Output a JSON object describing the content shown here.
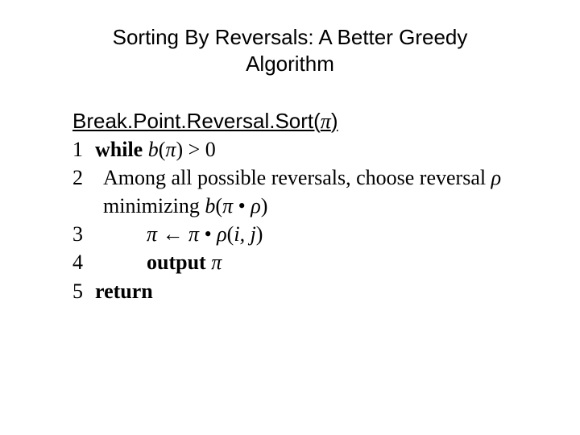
{
  "title": "Sorting By Reversals: A Better Greedy Algorithm",
  "fn": {
    "name_pre": "Break.Point.Reversal.Sort(",
    "name_arg": "π",
    "name_post": ")"
  },
  "steps": {
    "s1_num": "1",
    "s1_while": "while",
    "s1_b": "b",
    "s1_rest1": "(",
    "s1_pi": "π",
    "s1_rest2": ") > 0",
    "s2_num": "2",
    "s2_text1": "Among all possible reversals, choose reversal  ",
    "s2_rho": "ρ",
    "s2_text2": "  minimizing ",
    "s2_b": "b",
    "s2_paren": "(",
    "s2_pi": "π",
    "s2_dot": " • ",
    "s2_rho2": "ρ",
    "s2_close": ")",
    "s3_num": "3",
    "s3_pi1": "π",
    "s3_arrow": " ← ",
    "s3_pi2": "π",
    "s3_dot": " • ",
    "s3_rho": "ρ",
    "s3_paren": "(",
    "s3_i": "i",
    "s3_comma": ", ",
    "s3_j": "j",
    "s3_close": ")",
    "s4_num": "4",
    "s4_out": "output",
    "s4_pi": " π",
    "s5_num": "5",
    "s5_ret": "return"
  }
}
